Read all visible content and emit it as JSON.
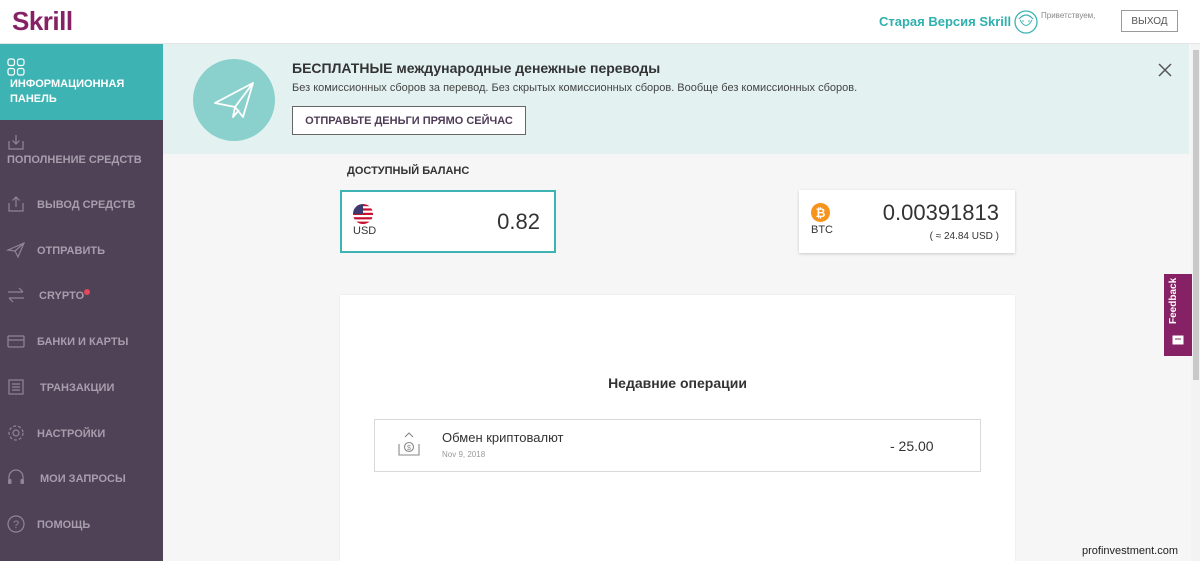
{
  "header": {
    "logo": "Skrill",
    "old_version": "Старая Версия Skrill",
    "greeting": "Приветствуем,",
    "exit": "ВЫХОД"
  },
  "sidebar": {
    "active": {
      "label": "ИНФОРМАЦИОННАЯ ПАНЕЛЬ",
      "icon": "dashboard-grid-icon"
    },
    "items": [
      {
        "label": "ПОПОЛНЕНИЕ СРЕДСТВ",
        "icon": "download-icon"
      },
      {
        "label": "ВЫВОД СРЕДСТВ",
        "icon": "upload-icon"
      },
      {
        "label": "ОТПРАВИТЬ",
        "icon": "paper-plane-icon"
      },
      {
        "label": "CRYPTO",
        "icon": "exchange-arrows-icon"
      },
      {
        "label": "БАНКИ И КАРТЫ",
        "icon": "card-icon"
      },
      {
        "label": "ТРАНЗАКЦИИ",
        "icon": "list-icon"
      },
      {
        "label": "НАСТРОЙКИ",
        "icon": "gear-icon"
      },
      {
        "label": "МОИ ЗАПРОСЫ",
        "icon": "headset-icon"
      },
      {
        "label": "ПОМОЩЬ",
        "icon": "question-icon"
      }
    ]
  },
  "banner": {
    "title": "БЕСПЛАТНЫЕ международные денежные переводы",
    "subtitle": "Без комиссионных сборов за перевод. Без скрытых комиссионных сборов. Вообще без комиссионных сборов.",
    "button": "ОТПРАВЬТЕ ДЕНЬГИ ПРЯМО СЕЙЧАС"
  },
  "balance": {
    "title": "ДОСТУПНЫЙ БАЛАНС",
    "usd": {
      "currency": "USD",
      "amount": "0.82"
    },
    "btc": {
      "currency": "BTC",
      "amount": "0.00391813",
      "approx": "( ≈ 24.84 USD )"
    }
  },
  "recent": {
    "title": "Недавние операции",
    "transactions": [
      {
        "name": "Обмен криптовалют",
        "date": "Nov 9, 2018",
        "amount": "- 25.00"
      }
    ]
  },
  "feedback": {
    "label": "Feedback"
  },
  "watermark": "profinvestment.com",
  "colors": {
    "brand": "#862165",
    "accent": "#3eb3b3",
    "sidebar": "#4f4156",
    "banner_bg": "#e3f2f1"
  }
}
